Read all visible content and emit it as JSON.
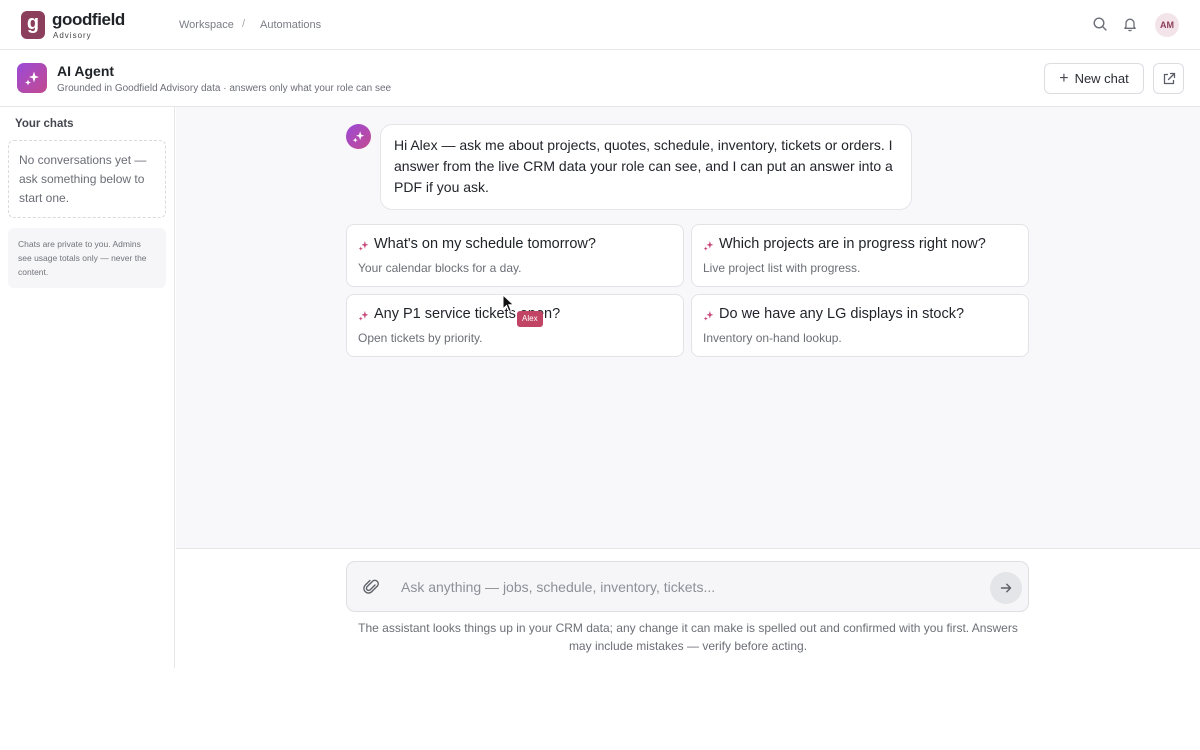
{
  "brand": {
    "mark": "g",
    "name": "goodfield",
    "sub": "Advisory"
  },
  "nav": {
    "workspace": "Workspace",
    "separator": "/",
    "automations": "Automations"
  },
  "user": {
    "initials": "AM"
  },
  "agent": {
    "title": "AI Agent",
    "subtitle": "Grounded in Goodfield Advisory data · answers only what your role can see",
    "new_chat_label": "New chat"
  },
  "sidebar": {
    "title": "Your chats",
    "empty_text": "No conversations yet — ask something below to start one.",
    "privacy_note": "Chats are private to you. Admins see usage totals only — never the content."
  },
  "chat": {
    "greeting": "Hi Alex — ask me about projects, quotes, schedule, inventory, tickets or orders. I answer from the live CRM data your role can see, and I can put an answer into a PDF if you ask."
  },
  "suggestions": [
    {
      "question": "What's on my schedule tomorrow?",
      "desc": "Your calendar blocks for a day."
    },
    {
      "question": "Which projects are in progress right now?",
      "desc": "Live project list with progress."
    },
    {
      "question": "Any P1 service tickets open?",
      "desc": "Open tickets by priority."
    },
    {
      "question": "Do we have any LG displays in stock?",
      "desc": "Inventory on-hand lookup."
    }
  ],
  "cursor": {
    "label": "Alex"
  },
  "composer": {
    "placeholder": "Ask anything — jobs, schedule, inventory, tickets...",
    "value": "",
    "disclaimer": "The assistant looks things up in your CRM data; any change it can make is spelled out and confirmed with you first. Answers may include mistakes — verify before acting."
  },
  "colors": {
    "brand": "#8c3f5c",
    "accent_start": "#9b4ad8",
    "accent_end": "#c34a8e",
    "cursor_tag": "#c24465"
  },
  "icons": [
    "search-icon",
    "bell-icon",
    "sparkle-icon",
    "plus-icon",
    "external-link-icon",
    "paperclip-icon",
    "arrow-right-icon"
  ]
}
